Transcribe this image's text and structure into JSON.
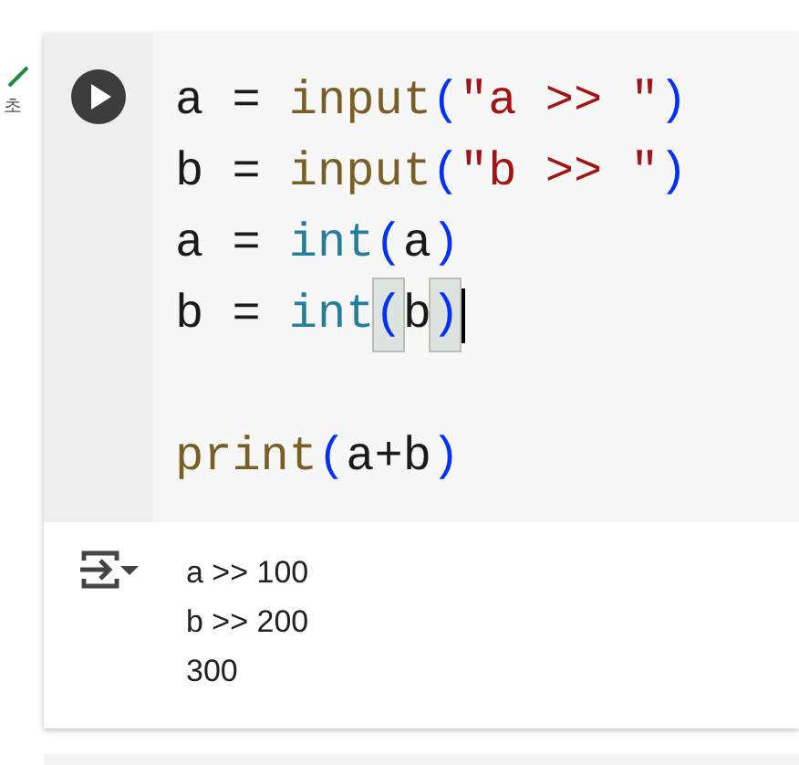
{
  "gutter": {
    "status_mark": "초"
  },
  "cell": {
    "code_lines": [
      {
        "cursor": false,
        "tokens": [
          {
            "text": "a = ",
            "kind": "plain"
          },
          {
            "text": "input",
            "kind": "builtin"
          },
          {
            "text": "(",
            "kind": "paren"
          },
          {
            "text": "\"a >> \"",
            "kind": "string"
          },
          {
            "text": ")",
            "kind": "paren"
          }
        ]
      },
      {
        "cursor": false,
        "tokens": [
          {
            "text": "b = ",
            "kind": "plain"
          },
          {
            "text": "input",
            "kind": "builtin"
          },
          {
            "text": "(",
            "kind": "paren"
          },
          {
            "text": "\"b >> \"",
            "kind": "string"
          },
          {
            "text": ")",
            "kind": "paren"
          }
        ]
      },
      {
        "cursor": false,
        "tokens": [
          {
            "text": "a = ",
            "kind": "plain"
          },
          {
            "text": "int",
            "kind": "type"
          },
          {
            "text": "(",
            "kind": "paren"
          },
          {
            "text": "a",
            "kind": "plain"
          },
          {
            "text": ")",
            "kind": "paren"
          }
        ]
      },
      {
        "cursor": true,
        "tokens": [
          {
            "text": "b = ",
            "kind": "plain"
          },
          {
            "text": "int",
            "kind": "type"
          },
          {
            "text": "(",
            "kind": "paren-match"
          },
          {
            "text": "b",
            "kind": "plain"
          },
          {
            "text": ")",
            "kind": "paren-match"
          }
        ]
      },
      {
        "cursor": false
      },
      {
        "cursor": false,
        "tokens": [
          {
            "text": "print",
            "kind": "builtin"
          },
          {
            "text": "(",
            "kind": "paren"
          },
          {
            "text": "a+b",
            "kind": "plain"
          },
          {
            "text": ")",
            "kind": "paren"
          }
        ]
      }
    ],
    "output_lines": [
      "a >> 100",
      "b >> 200",
      "300"
    ]
  }
}
